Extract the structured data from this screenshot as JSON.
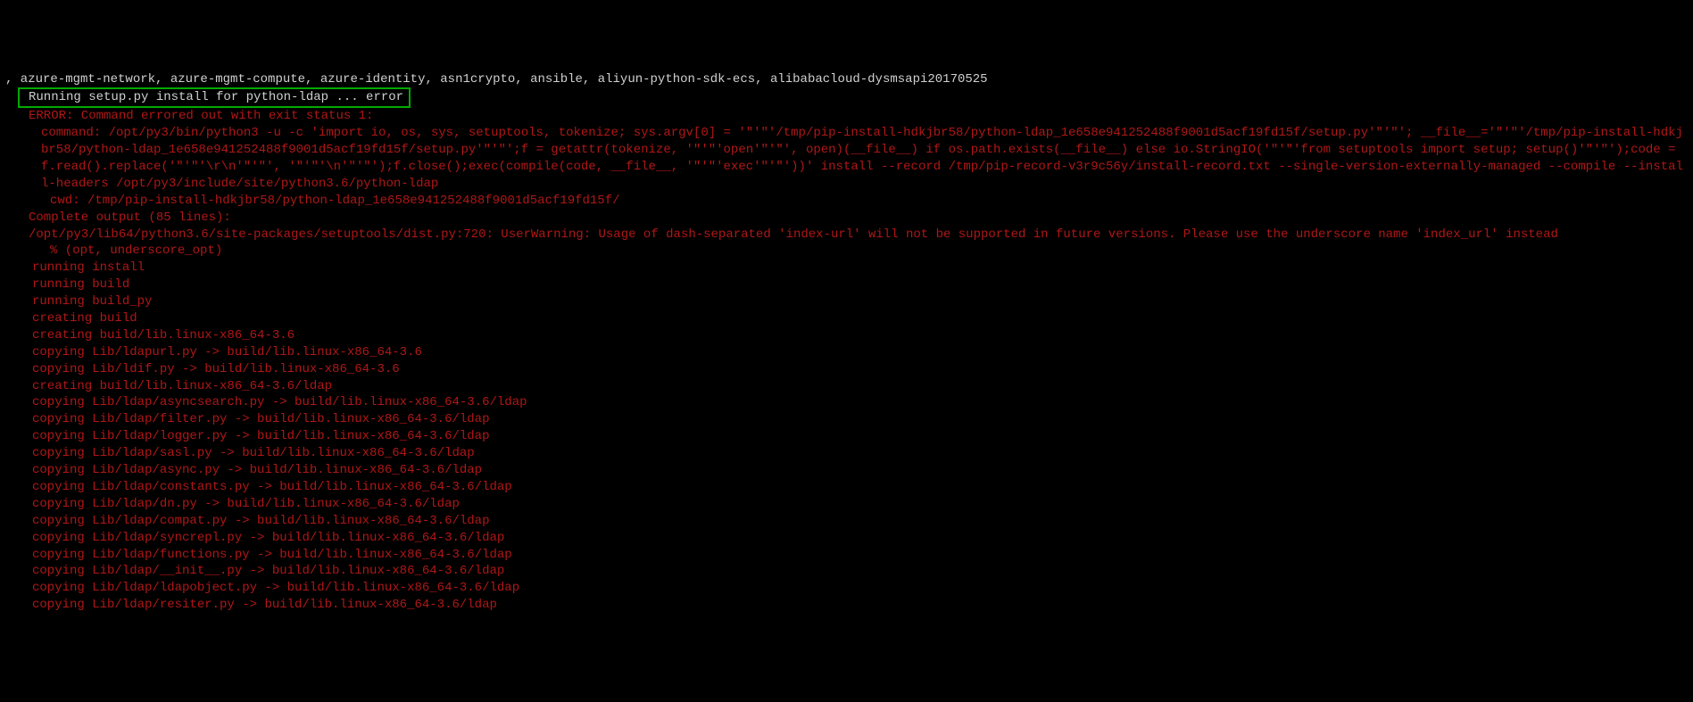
{
  "header": {
    "packages": ", azure-mgmt-network, azure-mgmt-compute, azure-identity, asn1crypto, ansible, aliyun-python-sdk-ecs, alibabacloud-dysmsapi20170525"
  },
  "highlight": {
    "text": "Running setup.py install for python-ldap ... error"
  },
  "error": {
    "lines": [
      {
        "cls": "i1",
        "text": "ERROR: Command errored out with exit status 1:"
      },
      {
        "cls": "i2",
        "text": "command: /opt/py3/bin/python3 -u -c 'import io, os, sys, setuptools, tokenize; sys.argv[0] = '\"'\"'/tmp/pip-install-hdkjbr58/python-ldap_1e658e941252488f9001d5acf19fd15f/setup.py'\"'\"'; __file__='\"'\"'/tmp/pip-install-hdkjbr58/python-ldap_1e658e941252488f9001d5acf19fd15f/setup.py'\"'\"';f = getattr(tokenize, '\"'\"'open'\"'\"', open)(__file__) if os.path.exists(__file__) else io.StringIO('\"'\"'from setuptools import setup; setup()'\"'\"');code = f.read().replace('\"'\"'\\r\\n'\"'\"', '\"'\"'\\n'\"'\"');f.close();exec(compile(code, __file__, '\"'\"'exec'\"'\"'))' install --record /tmp/pip-record-v3r9c56y/install-record.txt --single-version-externally-managed --compile --install-headers /opt/py3/include/site/python3.6/python-ldap"
      },
      {
        "cls": "i4",
        "text": "cwd: /tmp/pip-install-hdkjbr58/python-ldap_1e658e941252488f9001d5acf19fd15f/"
      },
      {
        "cls": "i1",
        "text": "Complete output (85 lines):"
      },
      {
        "cls": "i1",
        "text": "/opt/py3/lib64/python3.6/site-packages/setuptools/dist.py:720: UserWarning: Usage of dash-separated 'index-url' will not be supported in future versions. Please use the underscore name 'index_url' instead"
      },
      {
        "cls": "i4",
        "text": "% (opt, underscore_opt)"
      },
      {
        "cls": "i3",
        "text": "running install"
      },
      {
        "cls": "i3",
        "text": "running build"
      },
      {
        "cls": "i3",
        "text": "running build_py"
      },
      {
        "cls": "i3",
        "text": "creating build"
      },
      {
        "cls": "i3",
        "text": "creating build/lib.linux-x86_64-3.6"
      },
      {
        "cls": "i3",
        "text": "copying Lib/ldapurl.py -> build/lib.linux-x86_64-3.6"
      },
      {
        "cls": "i3",
        "text": "copying Lib/ldif.py -> build/lib.linux-x86_64-3.6"
      },
      {
        "cls": "i3",
        "text": "creating build/lib.linux-x86_64-3.6/ldap"
      },
      {
        "cls": "i3",
        "text": "copying Lib/ldap/asyncsearch.py -> build/lib.linux-x86_64-3.6/ldap"
      },
      {
        "cls": "i3",
        "text": "copying Lib/ldap/filter.py -> build/lib.linux-x86_64-3.6/ldap"
      },
      {
        "cls": "i3",
        "text": "copying Lib/ldap/logger.py -> build/lib.linux-x86_64-3.6/ldap"
      },
      {
        "cls": "i3",
        "text": "copying Lib/ldap/sasl.py -> build/lib.linux-x86_64-3.6/ldap"
      },
      {
        "cls": "i3",
        "text": "copying Lib/ldap/async.py -> build/lib.linux-x86_64-3.6/ldap"
      },
      {
        "cls": "i3",
        "text": "copying Lib/ldap/constants.py -> build/lib.linux-x86_64-3.6/ldap"
      },
      {
        "cls": "i3",
        "text": "copying Lib/ldap/dn.py -> build/lib.linux-x86_64-3.6/ldap"
      },
      {
        "cls": "i3",
        "text": "copying Lib/ldap/compat.py -> build/lib.linux-x86_64-3.6/ldap"
      },
      {
        "cls": "i3",
        "text": "copying Lib/ldap/syncrepl.py -> build/lib.linux-x86_64-3.6/ldap"
      },
      {
        "cls": "i3",
        "text": "copying Lib/ldap/functions.py -> build/lib.linux-x86_64-3.6/ldap"
      },
      {
        "cls": "i3",
        "text": "copying Lib/ldap/__init__.py -> build/lib.linux-x86_64-3.6/ldap"
      },
      {
        "cls": "i3",
        "text": "copying Lib/ldap/ldapobject.py -> build/lib.linux-x86_64-3.6/ldap"
      },
      {
        "cls": "i3",
        "text": "copying Lib/ldap/resiter.py -> build/lib.linux-x86_64-3.6/ldap"
      }
    ]
  }
}
